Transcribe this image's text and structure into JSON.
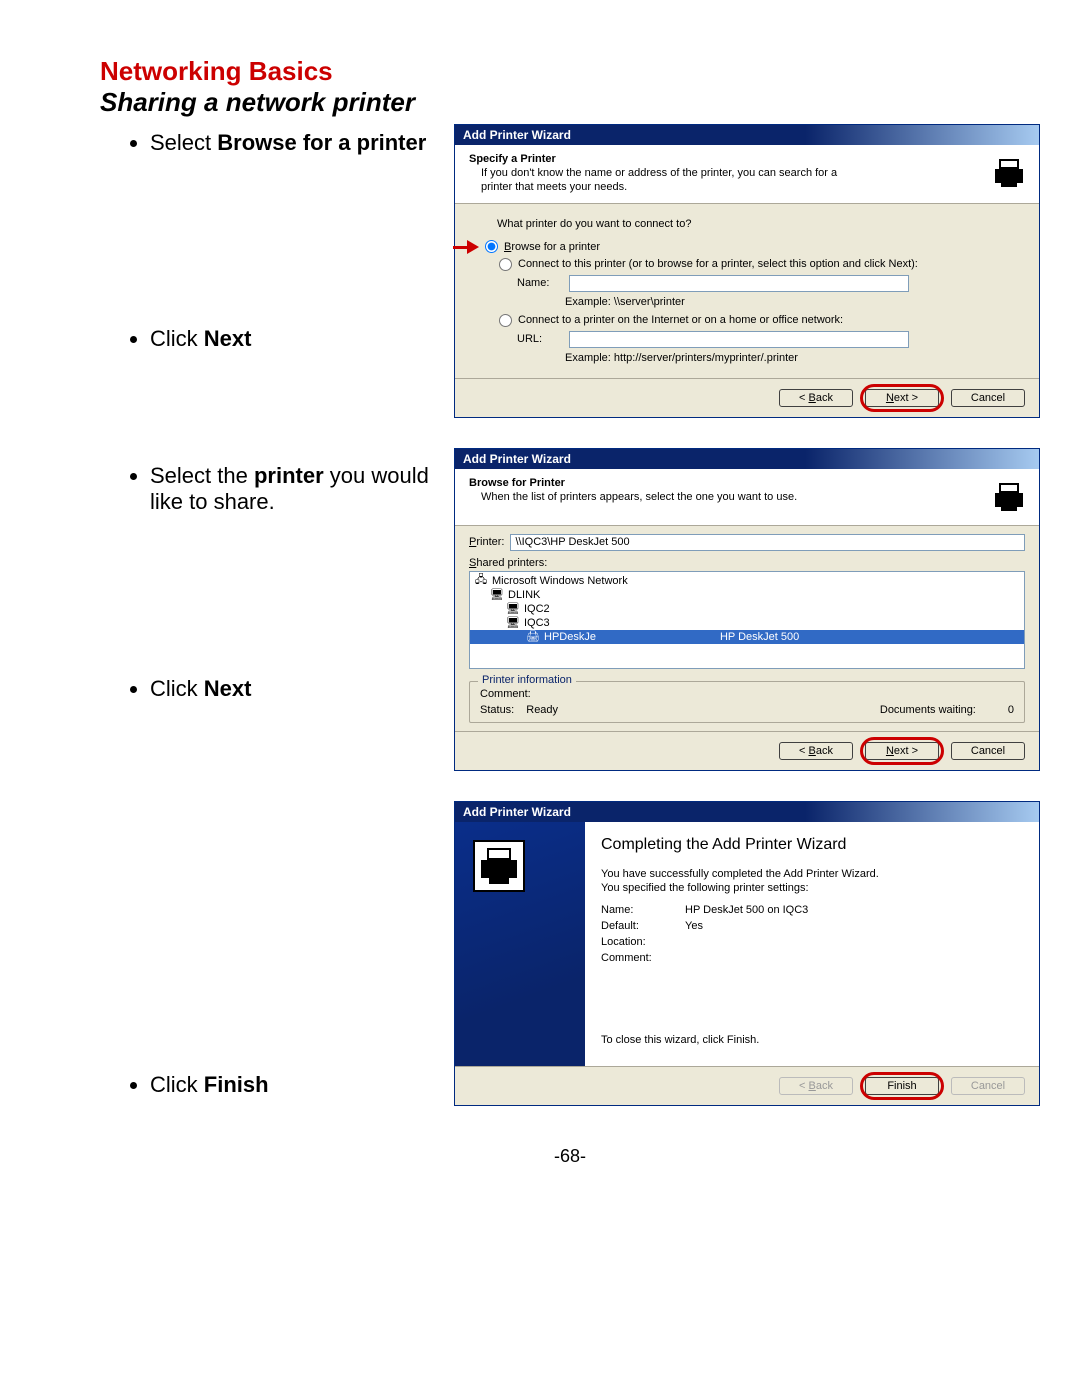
{
  "headings": {
    "h1": "Networking Basics",
    "h2": "Sharing a network printer"
  },
  "steps": {
    "s1a": "Select ",
    "s1b": "Browse for a printer",
    "s2a": "Click ",
    "s2b": "Next",
    "s3a": "Select the ",
    "s3b": "printer",
    "s3c": " you would like to share.",
    "s4a": "Click ",
    "s4b": "Next",
    "s5a": "Click ",
    "s5b": "Finish"
  },
  "wiz_title": "Add Printer Wizard",
  "w1": {
    "header_title": "Specify a Printer",
    "header_sub": "If you don't know the name or address of the printer, you can search for a printer that meets your needs.",
    "prompt": "What printer do you want to connect to?",
    "opt_browse": "Browse for a printer",
    "opt_connect": "Connect to this printer (or to browse for a printer, select this option and click Next):",
    "name_label": "Name:",
    "example1": "Example: \\\\server\\printer",
    "opt_internet": "Connect to a printer on the Internet or on a home or office network:",
    "url_label": "URL:",
    "example2": "Example: http://server/printers/myprinter/.printer"
  },
  "w2": {
    "header_title": "Browse for Printer",
    "header_sub": "When the list of printers appears, select the one you want to use.",
    "printer_label": "Printer:",
    "printer_value": "\\\\IQC3\\HP DeskJet 500",
    "shared_label": "Shared printers:",
    "tree": {
      "root": "Microsoft Windows Network",
      "n1": "DLINK",
      "n2": "IQC2",
      "n3": "IQC3",
      "sel_name": "HPDeskJe",
      "sel_model": "HP DeskJet 500"
    },
    "info_title": "Printer information",
    "comment_label": "Comment:",
    "status_label": "Status:",
    "status_value": "Ready",
    "docs_label": "Documents waiting:",
    "docs_value": "0"
  },
  "w3": {
    "title": "Completing the Add Printer Wizard",
    "line1": "You have successfully completed the Add Printer Wizard.",
    "line2": "You specified the following printer settings:",
    "name_label": "Name:",
    "name_value": "HP DeskJet 500 on IQC3",
    "default_label": "Default:",
    "default_value": "Yes",
    "location_label": "Location:",
    "comment_label": "Comment:",
    "close_text": "To close this wizard, click Finish."
  },
  "buttons": {
    "back": "< Back",
    "next": "Next >",
    "cancel": "Cancel",
    "finish": "Finish"
  },
  "pagenum": "-68-"
}
